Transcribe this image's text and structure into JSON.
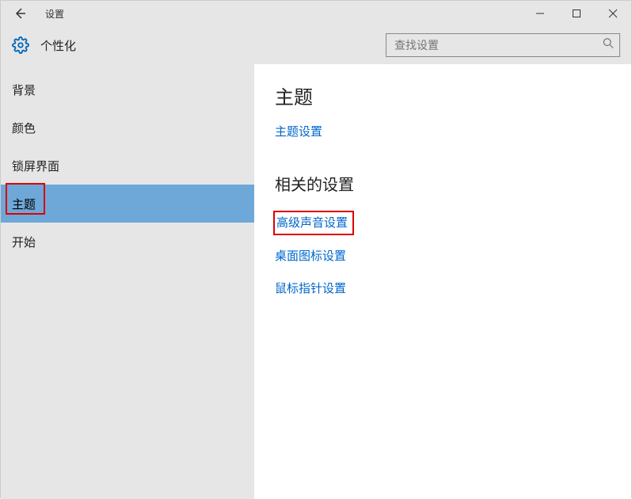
{
  "titlebar": {
    "title": "设置"
  },
  "header": {
    "category": "个性化",
    "search_placeholder": "查找设置"
  },
  "sidebar": {
    "items": [
      {
        "label": "背景"
      },
      {
        "label": "颜色"
      },
      {
        "label": "锁屏界面"
      },
      {
        "label": "主题"
      },
      {
        "label": "开始"
      }
    ]
  },
  "content": {
    "section1_title": "主题",
    "theme_settings_link": "主题设置",
    "section2_title": "相关的设置",
    "related": {
      "sound": "高级声音设置",
      "desktop_icons": "桌面图标设置",
      "mouse_pointer": "鼠标指针设置"
    }
  }
}
